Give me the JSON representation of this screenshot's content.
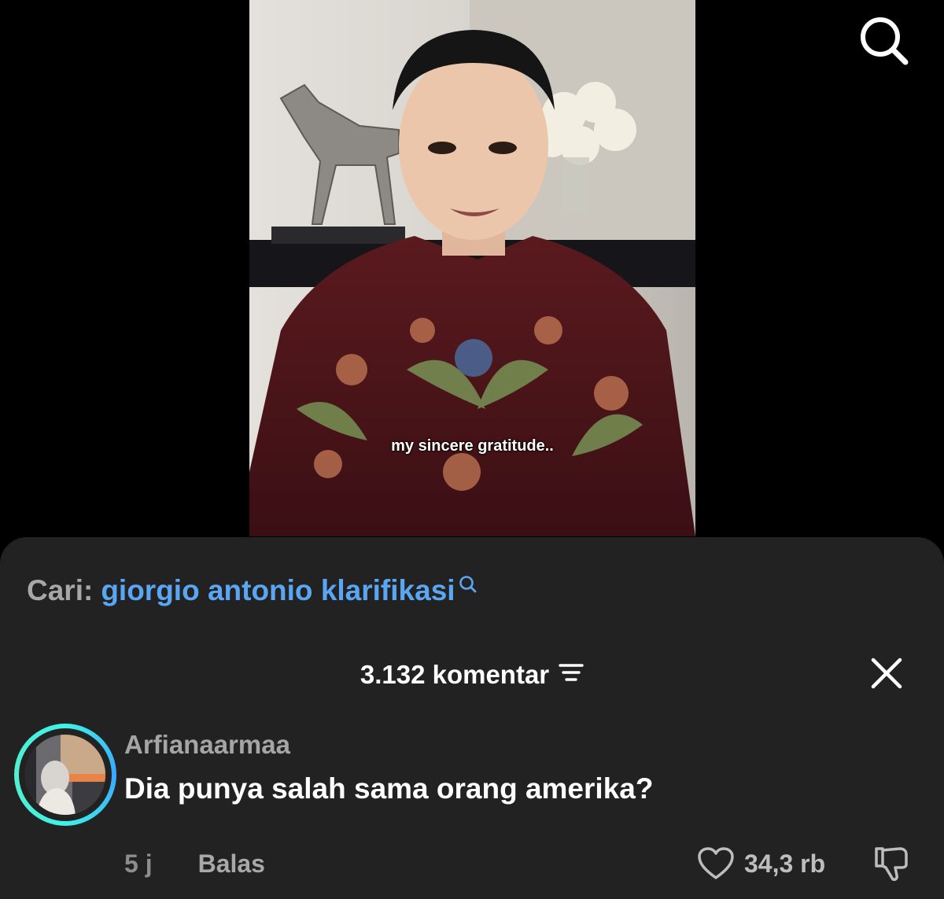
{
  "video": {
    "caption": "my sincere gratitude.."
  },
  "search_suggestion": {
    "label": "Cari:",
    "query": "giorgio antonio klarifikasi"
  },
  "comments_header": {
    "count_label": "3.132 komentar"
  },
  "comments": [
    {
      "username": "Arfianaarmaa",
      "text": "Dia punya salah sama orang amerika?",
      "time": "5 j",
      "reply_label": "Balas",
      "likes": "34,3 rb"
    }
  ],
  "colors": {
    "sheet_bg": "#222222",
    "link_blue": "#5aa6f2",
    "ring_start": "#3ff1e6",
    "ring_end": "#3aa8ff"
  },
  "icons": [
    "search-icon",
    "filter-icon",
    "close-icon",
    "heart-icon",
    "dislike-icon"
  ]
}
